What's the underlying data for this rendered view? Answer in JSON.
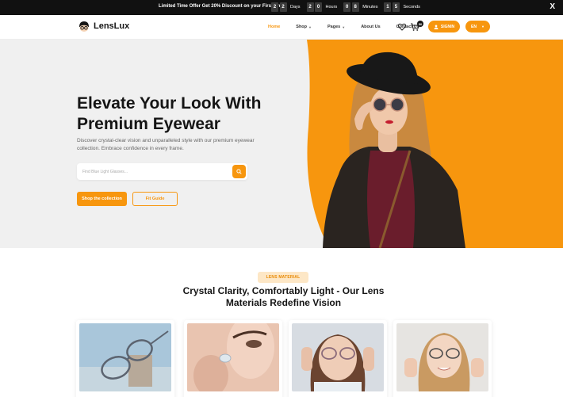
{
  "announcement": {
    "text": "Limited Time Offer Get 20% Discount on your First order",
    "countdown": [
      {
        "digits": [
          "2",
          "2"
        ],
        "unit": "Days"
      },
      {
        "digits": [
          "2",
          "0"
        ],
        "unit": "Hours"
      },
      {
        "digits": [
          "0",
          "8"
        ],
        "unit": "Minutes"
      },
      {
        "digits": [
          "1",
          "5"
        ],
        "unit": "Seconds"
      }
    ],
    "close_label": "X"
  },
  "header": {
    "logo_text": "LensLux",
    "nav": [
      {
        "label": "Home",
        "active": true
      },
      {
        "label": "Shop"
      },
      {
        "label": "Pages"
      },
      {
        "label": "About Us"
      },
      {
        "label": "Contact Us"
      }
    ],
    "cart_count": "50",
    "signin_label": "SIGNIN",
    "language": "EN",
    "icons": [
      "heart-icon",
      "cart-icon",
      "user-icon",
      "chevron-down-icon"
    ]
  },
  "hero": {
    "title": "Elevate Your Look With Premium Eyewear",
    "subtitle": "Discover crystal-clear vision and unparalleled style with our premium eyewear collection. Embrace confidence in every frame.",
    "search_placeholder": "Find Blue Light Glasses...",
    "primary_cta": "Shop the collection",
    "secondary_cta": "Fit Guide"
  },
  "lens_section": {
    "badge": "LENS MATERIAL",
    "title": "Crystal Clarity, Comfortably Light - Our Lens Materials Redefine Vision"
  },
  "colors": {
    "accent": "#f7960e",
    "dark": "#111111",
    "hero_bg": "#f0f0f0",
    "badge_bg": "#fde7c6"
  }
}
